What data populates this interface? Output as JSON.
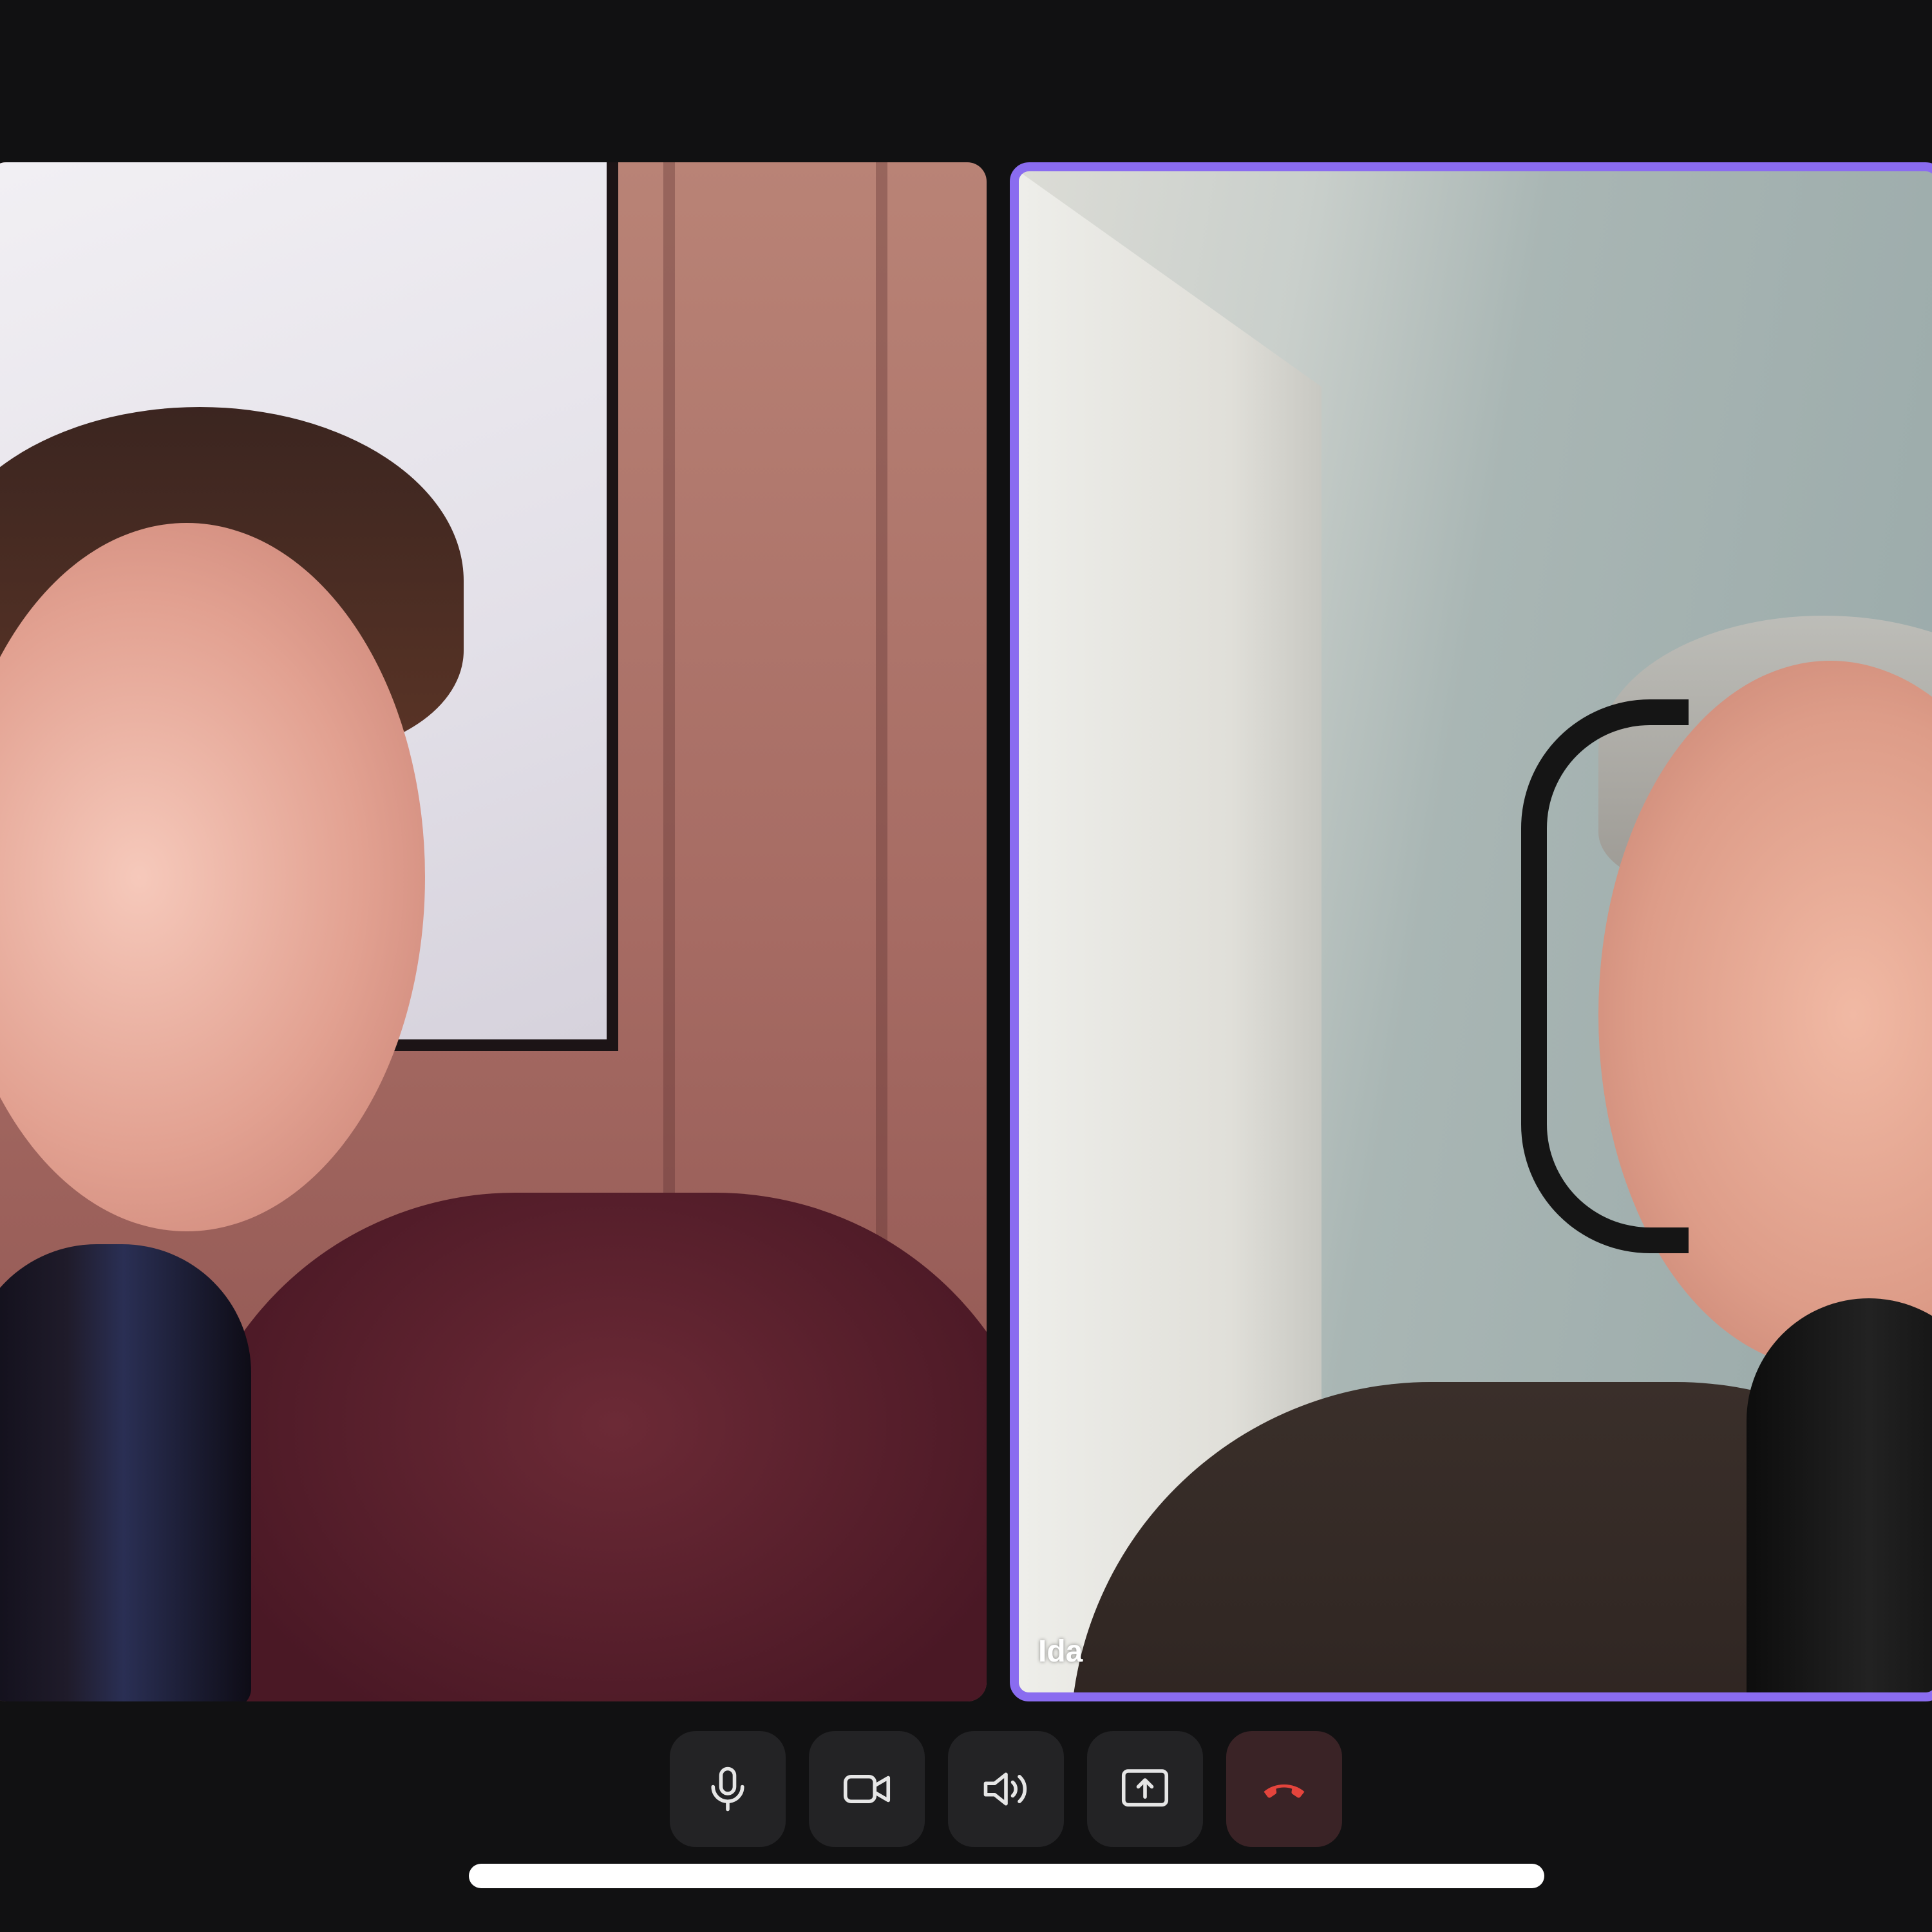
{
  "participants": [
    {
      "id": "left",
      "name": "",
      "speaking": false
    },
    {
      "id": "right",
      "name": "Ida",
      "speaking": true
    }
  ],
  "colors": {
    "background": "#111112",
    "active_speaker_border": "#8a6cf0",
    "control_button_bg": "#232325",
    "end_call_icon": "#e4443c"
  },
  "controls": [
    {
      "icon": "microphone-icon"
    },
    {
      "icon": "camera-icon"
    },
    {
      "icon": "speaker-icon"
    },
    {
      "icon": "share-screen-icon"
    },
    {
      "icon": "end-call-icon"
    }
  ]
}
